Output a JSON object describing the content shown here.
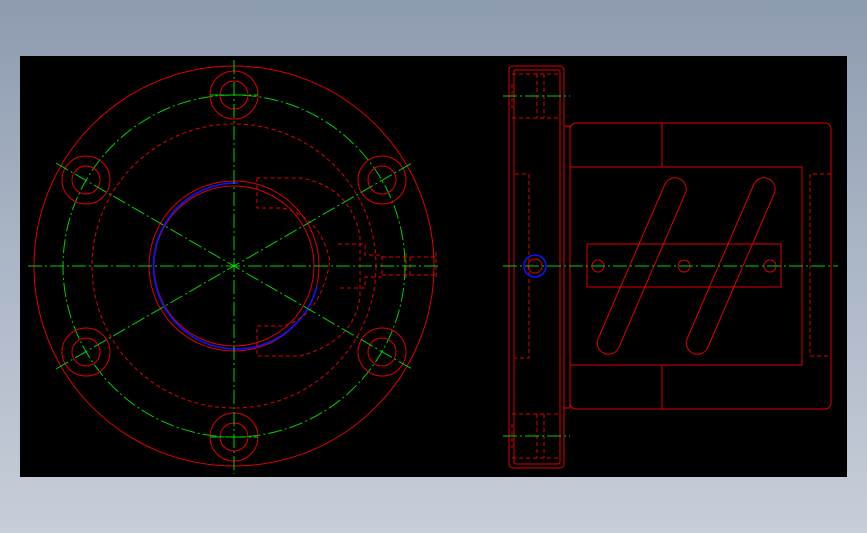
{
  "drawing": {
    "background": "#000000",
    "colors": {
      "outline": "#e00000",
      "centerline": "#00d000",
      "highlight": "#1010ff"
    },
    "views": [
      "front-view",
      "side-view"
    ]
  }
}
